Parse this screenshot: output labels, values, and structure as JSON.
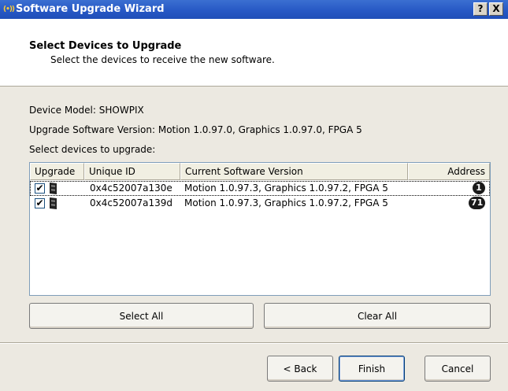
{
  "window": {
    "title": "Software Upgrade Wizard",
    "help_button": "?",
    "close_button": "X",
    "title_icon": "(•))"
  },
  "header": {
    "title": "Select Devices to Upgrade",
    "subtitle": "Select the devices to receive the new software."
  },
  "info": {
    "device_model_label": "Device Model:",
    "device_model_value": "SHOWPIX",
    "upgrade_version_label": "Upgrade Software Version:",
    "upgrade_version_value": "Motion 1.0.97.0, Graphics 1.0.97.0, FPGA 5",
    "select_label": "Select devices to upgrade:"
  },
  "list": {
    "columns": [
      "Upgrade",
      "Unique ID",
      "Current Software Version",
      "Address"
    ],
    "rows": [
      {
        "checked": "✔",
        "unique_id": "0x4c52007a130e",
        "version": "Motion 1.0.97.3, Graphics 1.0.97.2, FPGA 5",
        "address": "1"
      },
      {
        "checked": "✔",
        "unique_id": "0x4c52007a139d",
        "version": "Motion 1.0.97.3, Graphics 1.0.97.2, FPGA 5",
        "address": "71"
      }
    ]
  },
  "buttons": {
    "select_all": "Select All",
    "clear_all": "Clear All",
    "back": "< Back",
    "finish": "Finish",
    "cancel": "Cancel"
  },
  "colors": {
    "titlebar": "#2657c4",
    "dialog_bg": "#ece9e1",
    "badge": "#1a1a1a"
  }
}
